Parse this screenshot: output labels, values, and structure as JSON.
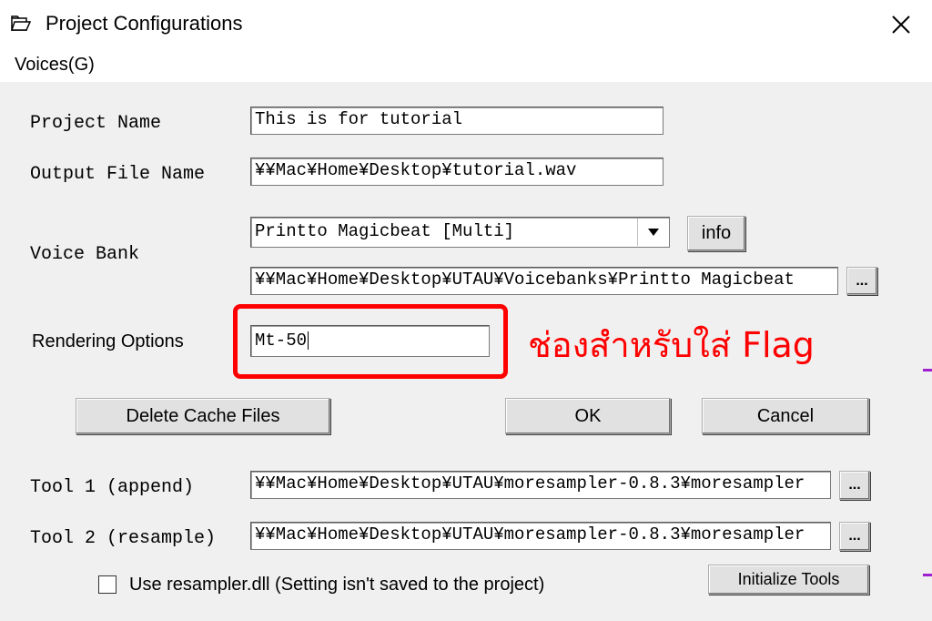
{
  "window": {
    "title": "Project Configurations"
  },
  "menu": {
    "voices": "Voices(G)"
  },
  "labels": {
    "project_name": "Project Name",
    "output_file_name": "Output File Name",
    "voice_bank": "Voice Bank",
    "rendering_options": "Rendering Options",
    "tool1": "Tool 1 (append)",
    "tool2": "Tool 2 (resample)"
  },
  "fields": {
    "project_name": "This is for tutorial",
    "output_file_name": "¥¥Mac¥Home¥Desktop¥tutorial.wav",
    "voice_bank_selected": "Printto Magicbeat [Multi]",
    "voice_bank_path": "¥¥Mac¥Home¥Desktop¥UTAU¥Voicebanks¥Printto Magicbeat",
    "rendering_options": "Mt-50",
    "tool1_path": "¥¥Mac¥Home¥Desktop¥UTAU¥moresampler-0.8.3¥moresampler",
    "tool2_path": "¥¥Mac¥Home¥Desktop¥UTAU¥moresampler-0.8.3¥moresampler"
  },
  "buttons": {
    "info": "info",
    "browse": "...",
    "delete_cache": "Delete Cache Files",
    "ok": "OK",
    "cancel": "Cancel",
    "initialize_tools": "Initialize Tools"
  },
  "checkbox": {
    "use_resampler_label": "Use resampler.dll (Setting isn't saved to the project)",
    "checked": false
  },
  "annotation": {
    "text": "ช่องสำหรับใส่ Flag",
    "color": "#ff0000"
  }
}
